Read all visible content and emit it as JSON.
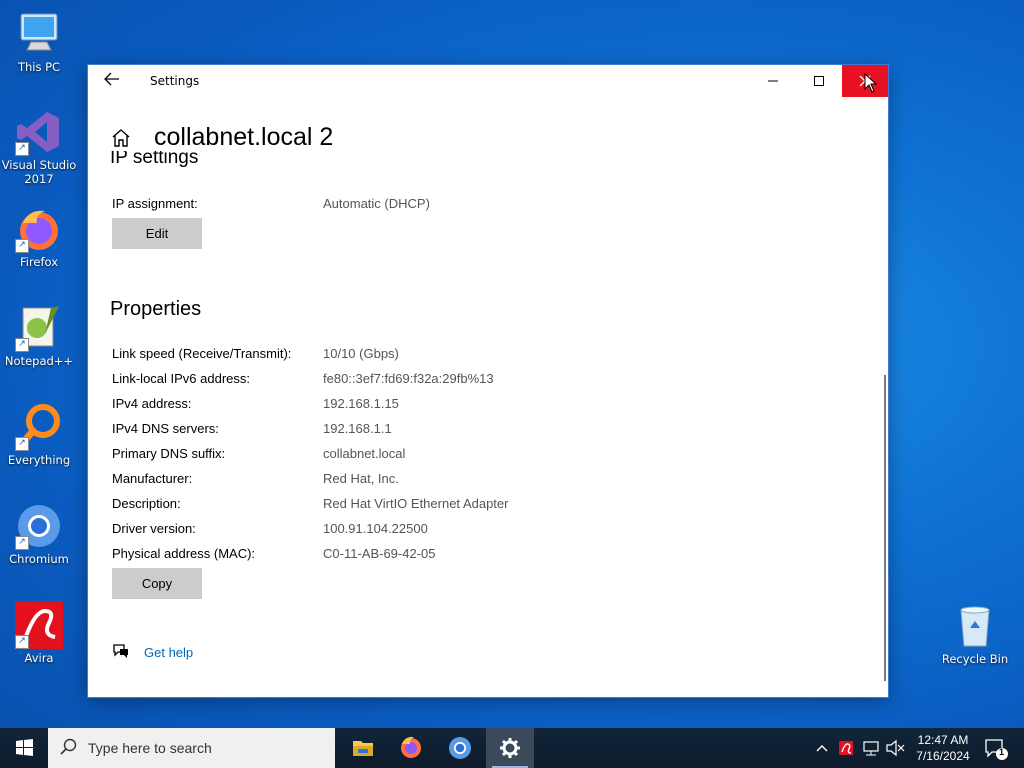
{
  "desktop": {
    "icons": [
      {
        "label": "This PC"
      },
      {
        "label": "Visual Studio 2017"
      },
      {
        "label": "Firefox"
      },
      {
        "label": "Notepad++"
      },
      {
        "label": "Everything"
      },
      {
        "label": "Chromium"
      },
      {
        "label": "Avira"
      },
      {
        "label": "Recycle Bin"
      }
    ]
  },
  "window": {
    "title": "Settings",
    "page_title": "collabnet.local 2",
    "ip_settings_heading": "IP settings",
    "ip_assignment": {
      "label": "IP assignment:",
      "value": "Automatic (DHCP)"
    },
    "edit_label": "Edit",
    "properties_heading": "Properties",
    "properties": [
      {
        "label": "Link speed (Receive/Transmit):",
        "value": "10/10 (Gbps)"
      },
      {
        "label": "Link-local IPv6 address:",
        "value": "fe80::3ef7:fd69:f32a:29fb%13"
      },
      {
        "label": "IPv4 address:",
        "value": "192.168.1.15"
      },
      {
        "label": "IPv4 DNS servers:",
        "value": "192.168.1.1"
      },
      {
        "label": "Primary DNS suffix:",
        "value": "collabnet.local"
      },
      {
        "label": "Manufacturer:",
        "value": "Red Hat, Inc."
      },
      {
        "label": "Description:",
        "value": "Red Hat VirtIO Ethernet Adapter"
      },
      {
        "label": "Driver version:",
        "value": "100.91.104.22500"
      },
      {
        "label": "Physical address (MAC):",
        "value": "C0-11-AB-69-42-05"
      }
    ],
    "copy_label": "Copy",
    "get_help_label": "Get help"
  },
  "taskbar": {
    "search_placeholder": "Type here to search",
    "time": "12:47 AM",
    "date": "7/16/2024",
    "notification_count": "1"
  },
  "colors": {
    "close_button": "#e81123",
    "link": "#0067b8",
    "button_bg": "#cccccc"
  }
}
